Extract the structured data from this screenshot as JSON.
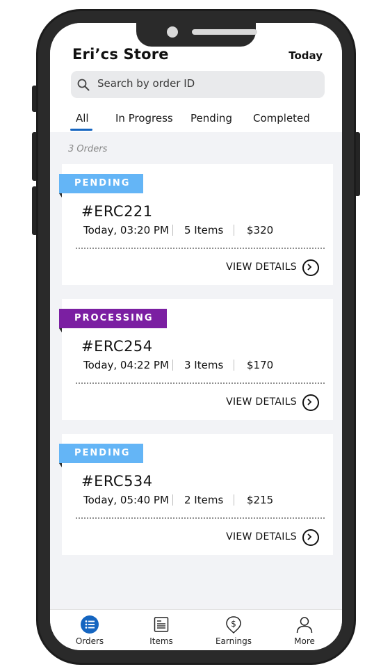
{
  "header": {
    "store_name": "Eri’cs Store",
    "date_filter": "Today"
  },
  "search": {
    "placeholder": "Search by order ID",
    "value": ""
  },
  "tabs": [
    {
      "label": "All",
      "active": true
    },
    {
      "label": "In Progress",
      "active": false
    },
    {
      "label": "Pending",
      "active": false
    },
    {
      "label": "Completed",
      "active": false
    }
  ],
  "order_count": "3 Orders",
  "orders": [
    {
      "status": "PENDING",
      "status_color": "#64b5f6",
      "id": "#ERC221",
      "time": "Today, 03:20 PM",
      "items": "5 Items",
      "amount": "$320",
      "action": "VIEW DETAILS"
    },
    {
      "status": "PROCESSING",
      "status_color": "#7b1fa2",
      "id": "#ERC254",
      "time": "Today, 04:22 PM",
      "items": "3 Items",
      "amount": "$170",
      "action": "VIEW DETAILS"
    },
    {
      "status": "PENDING",
      "status_color": "#64b5f6",
      "id": "#ERC534",
      "time": "Today, 05:40 PM",
      "items": "2 Items",
      "amount": "$215",
      "action": "VIEW DETAILS"
    }
  ],
  "nav": [
    {
      "label": "Orders",
      "icon": "list-icon",
      "active": true
    },
    {
      "label": "Items",
      "icon": "receipt-icon",
      "active": false
    },
    {
      "label": "Earnings",
      "icon": "dollar-pin-icon",
      "active": false
    },
    {
      "label": "More",
      "icon": "person-icon",
      "active": false
    }
  ],
  "colors": {
    "accent": "#1565c0",
    "pending": "#64b5f6",
    "processing": "#7b1fa2",
    "background": "#f2f3f6"
  }
}
